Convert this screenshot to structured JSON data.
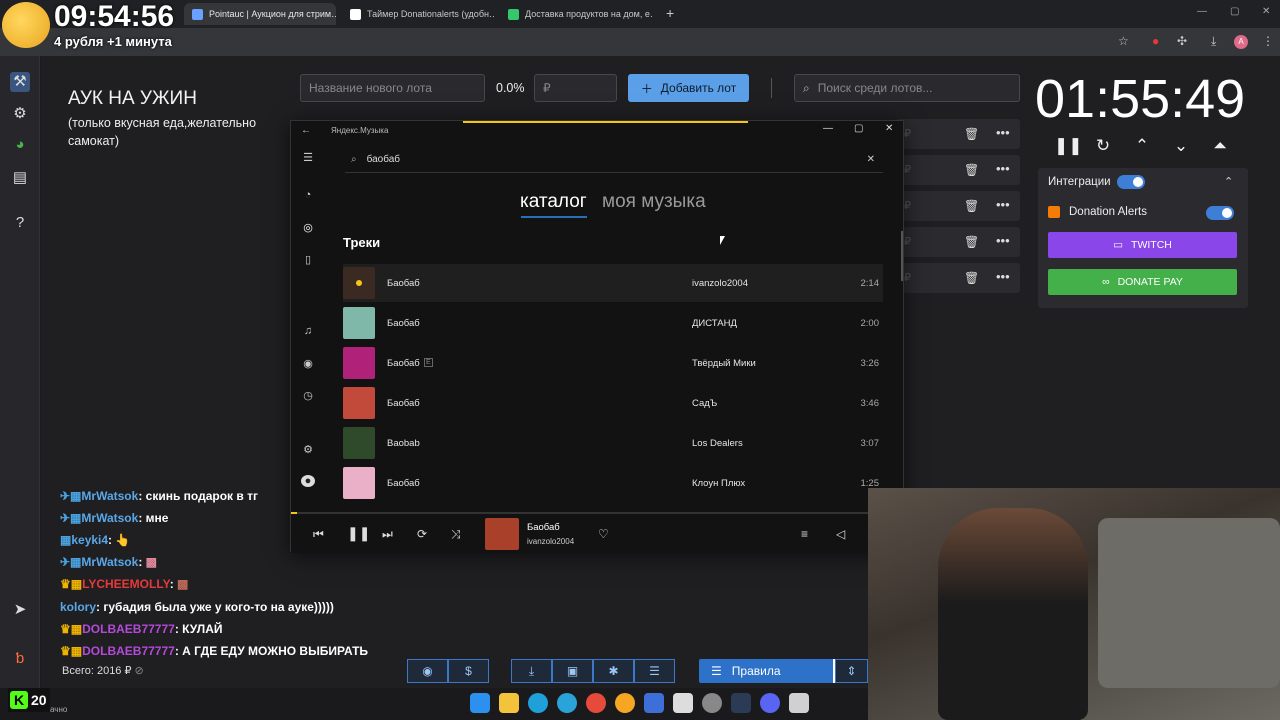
{
  "overlay": {
    "clock": "09:54:56",
    "sub": "4 рубля +1 минута"
  },
  "browser": {
    "tabs": [
      {
        "title": "Pointauc | Аукцион для стрим…",
        "favicon_color": "#6aa0ff",
        "active": true
      },
      {
        "title": "Таймер Donationalerts (удобн…",
        "favicon_color": "#ffffff",
        "active": false
      },
      {
        "title": "Доставка продуктов на дом, е…",
        "favicon_color": "#35c86b",
        "active": false
      }
    ],
    "new_tab": "+"
  },
  "sidebar": {
    "icons": [
      "gavel-icon",
      "gear-icon",
      "pie-chart-icon",
      "clipboard-icon",
      "help-icon",
      "telegram-icon",
      "b-logo-icon"
    ]
  },
  "auction": {
    "title": "АУК НА УЖИН",
    "description": "(только вкусная еда,желательно самокат)",
    "lot_name_placeholder": "Название нового лота",
    "percent": "0.0%",
    "amount_placeholder": "₽",
    "add_lot": "Добавить лот",
    "search_placeholder": "Поиск среди лотов...",
    "lot_currency": "₽"
  },
  "timer": {
    "value": "01:55:49"
  },
  "integrations": {
    "title": "Интеграции",
    "donation_alerts": "Donation Alerts",
    "twitch": "TWITCH",
    "donatepay": "DONATE PAY"
  },
  "music": {
    "app_title": "Яндекс.Музыка",
    "search_value": "баобаб",
    "tab_catalog": "каталог",
    "tab_my": "моя музыка",
    "tracks_heading": "Треки",
    "tracks": [
      {
        "title": "Баобаб",
        "artist": "ivanzolo2004",
        "duration": "2:14",
        "cover": "#3a2a22",
        "playing": true
      },
      {
        "title": "Баобаб",
        "artist": "ДИСТАНД",
        "duration": "2:00",
        "cover": "#7fb8a8"
      },
      {
        "title": "Баобаб",
        "artist": "Твёрдый Мики",
        "duration": "3:26",
        "cover": "#b0227a"
      },
      {
        "title": "Баобаб",
        "artist": "СадЪ",
        "duration": "3:46",
        "cover": "#c24a3a"
      },
      {
        "title": "Baobab",
        "artist": "Los Dealers",
        "duration": "3:07",
        "cover": "#2f4a2a"
      },
      {
        "title": "Баобаб",
        "artist": "Клоун Плюх",
        "duration": "1:25",
        "cover": "#e9b0c8"
      }
    ],
    "now_playing": {
      "title": "Баобаб",
      "artist": "ivanzolo2004",
      "progress": 0.01
    }
  },
  "chat": [
    {
      "user": "MrWatsok",
      "text": "скинь подарок в тг",
      "color": "blue",
      "prefix": "✈▦"
    },
    {
      "user": "MrWatsok",
      "text": "мне",
      "color": "blue",
      "prefix": "✈▦"
    },
    {
      "user": "keyki4",
      "text": "👆",
      "color": "blue",
      "prefix": "▦"
    },
    {
      "user": "MrWatsok",
      "text": "▩",
      "color": "blue",
      "prefix": "✈▦"
    },
    {
      "user": "LYCHEEMOLLY",
      "text": "▩",
      "color": "red",
      "prefix": "♛▦"
    },
    {
      "user": "kolory",
      "text": "губадия была уже у кого-то на ауке)))))",
      "color": "blue",
      "prefix": ""
    },
    {
      "user": "DOLBAEB77777",
      "text": "КУЛАЙ",
      "color": "purple",
      "prefix": "♛▦"
    },
    {
      "user": "DOLBAEB77777",
      "text": "А ГДЕ ЕДУ МОЖНО ВЫБИРАТЬ",
      "color": "purple",
      "prefix": "♛▦"
    }
  ],
  "total": "Всего: 2016 ₽",
  "toolbar": {
    "rules": "Правила",
    "percent": "%"
  },
  "kick": {
    "count": "20",
    "status": "ачно"
  }
}
